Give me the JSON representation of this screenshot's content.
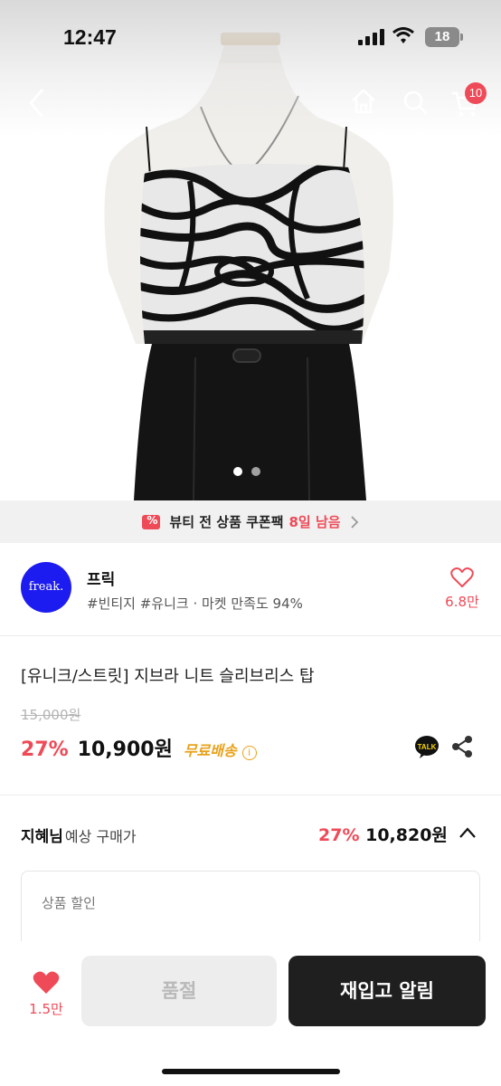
{
  "status_bar": {
    "time": "12:47",
    "battery": "18"
  },
  "nav": {
    "cart_count": "10"
  },
  "coupon_banner": {
    "text": "뷰티 전 상품 쿠폰팩",
    "days_left": "8일 남음"
  },
  "shop": {
    "logo_text": "freak.",
    "name": "프릭",
    "tags": "#빈티지 #유니크 · 마켓 만족도 94%",
    "likes": "6.8만"
  },
  "product": {
    "title": "[유니크/스트릿] 지브라 니트 슬리브리스 탑",
    "original_price": "15,000원",
    "discount": "27%",
    "price": "10,900원",
    "shipping": "무료배송",
    "talk_label": "TALK"
  },
  "estimate": {
    "user": "지혜님",
    "label": "예상 구매가",
    "discount": "27%",
    "price": "10,820원"
  },
  "discount_section": {
    "label": "상품 할인"
  },
  "bottom_bar": {
    "likes": "1.5만",
    "soldout_label": "품절",
    "restock_label": "재입고 알림"
  },
  "colors": {
    "accent": "#ef4a57",
    "shipping": "#e8a21b",
    "logo": "#1c1cf0",
    "primary_button": "#1f1f1f"
  }
}
